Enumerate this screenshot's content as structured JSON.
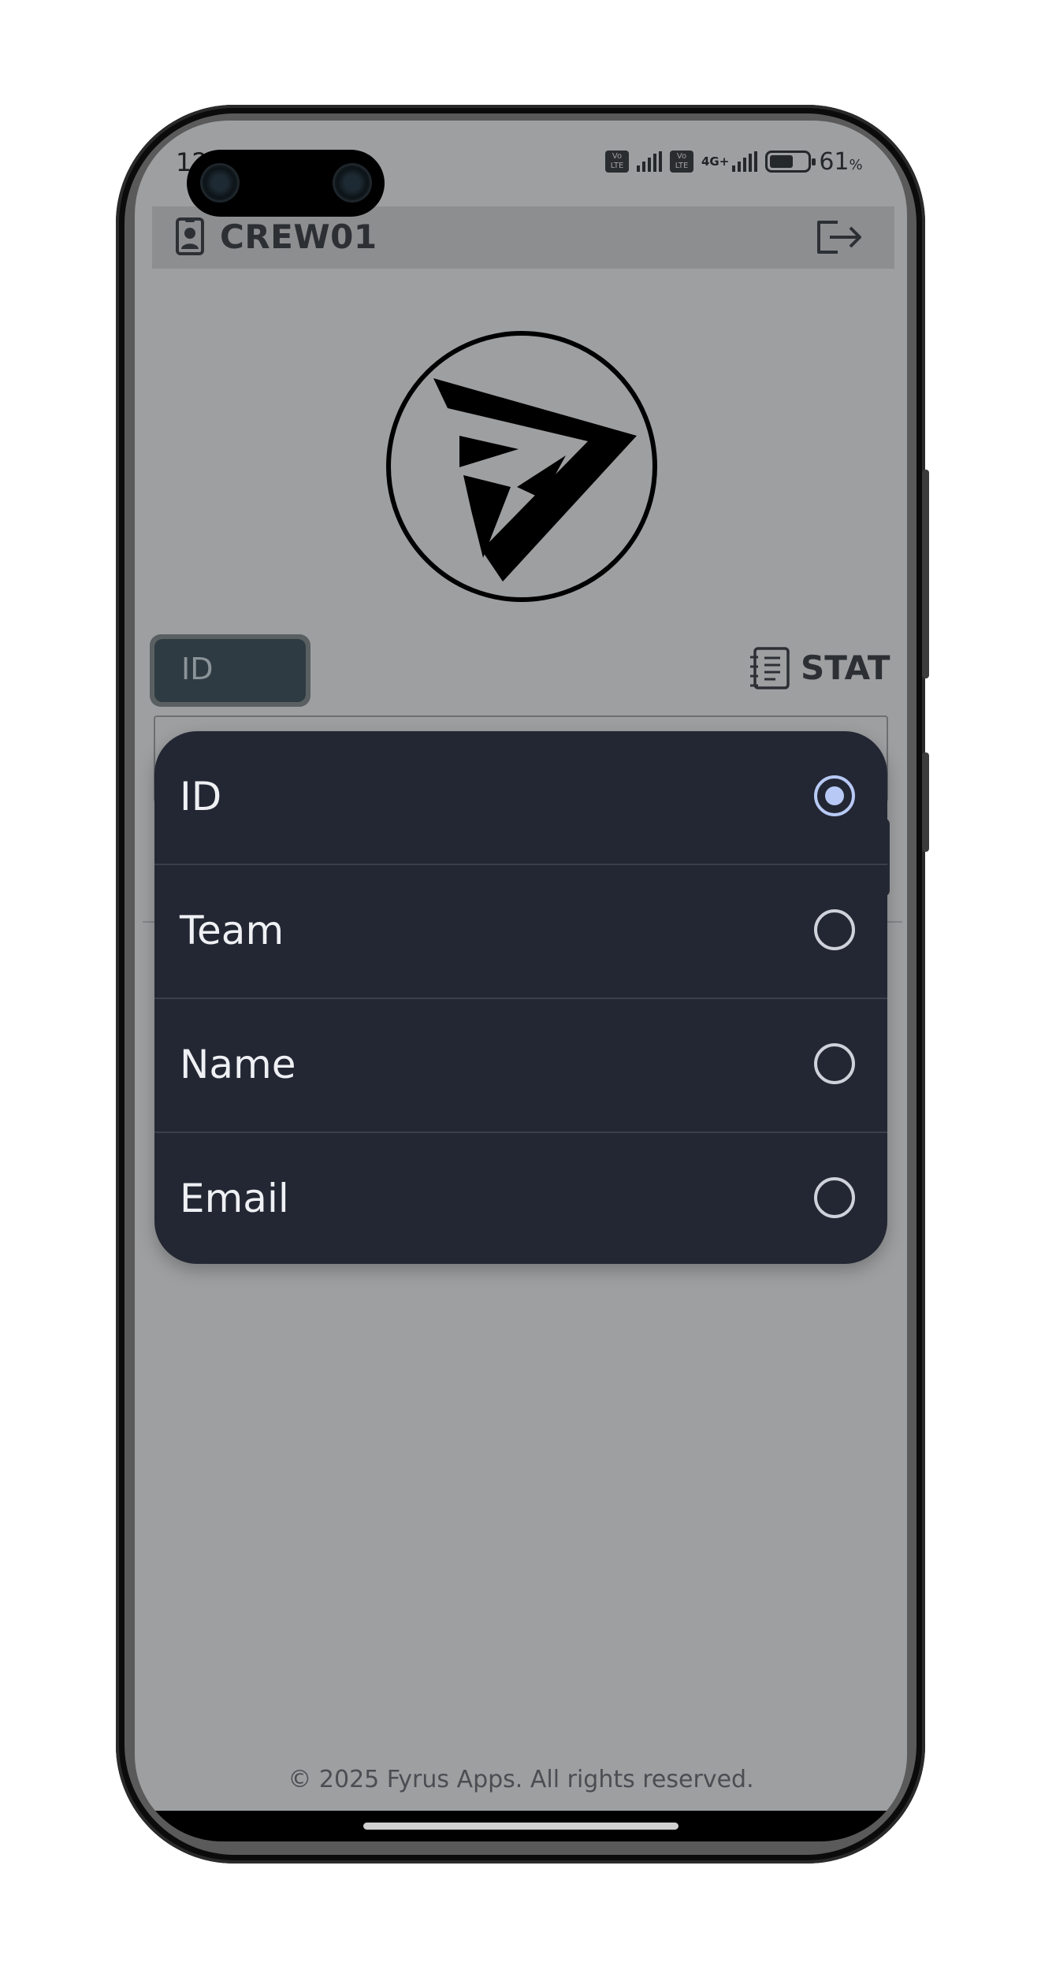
{
  "status_bar": {
    "time": "12",
    "network_tags": [
      "Vo LTE",
      "Vo LTE"
    ],
    "network_type": "4G+",
    "battery_level": "61",
    "battery_unit": "%"
  },
  "header": {
    "user_label": "CREW01"
  },
  "search_bar": {
    "selected_field": "ID",
    "stat_label": "STAT"
  },
  "popup": {
    "options": [
      {
        "label": "ID",
        "selected": true
      },
      {
        "label": "Team",
        "selected": false
      },
      {
        "label": "Name",
        "selected": false
      },
      {
        "label": "Email",
        "selected": false
      }
    ]
  },
  "footer": {
    "copyright": "© 2025 Fyrus Apps. All rights reserved."
  },
  "colors": {
    "overlay_bg": "#9e9fa1",
    "popup_bg": "#232733",
    "radio_selected": "#b8c9f5"
  }
}
